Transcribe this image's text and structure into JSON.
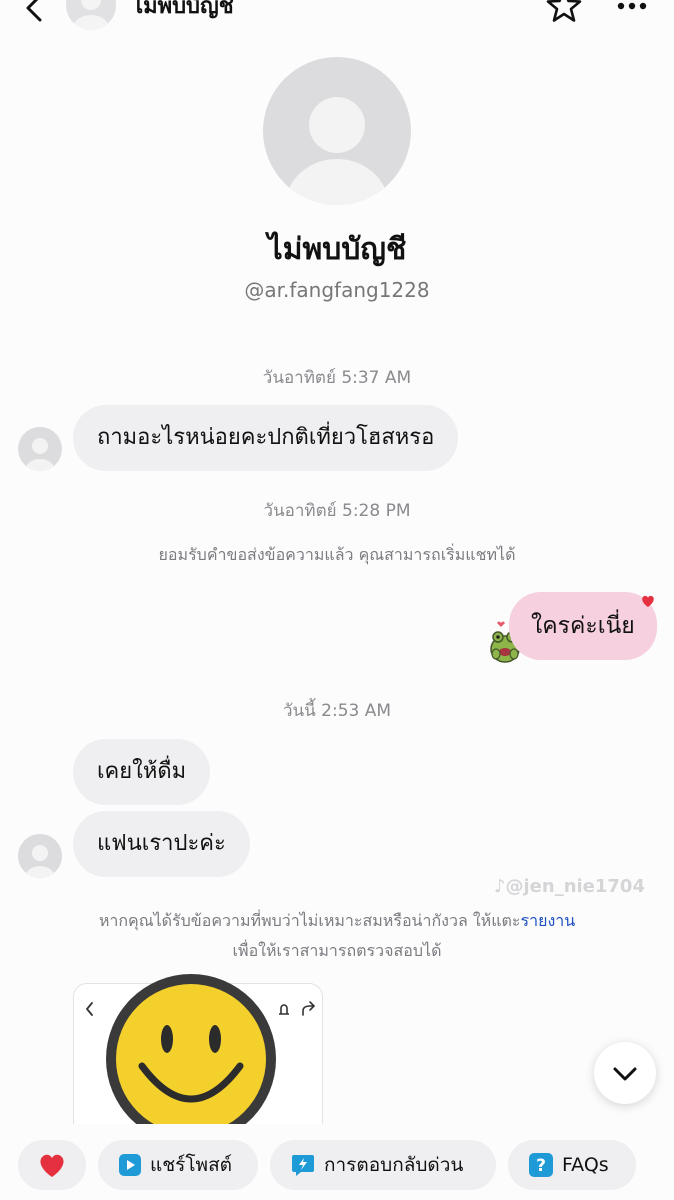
{
  "header": {
    "title": "ไม่พบบัญชี"
  },
  "profile": {
    "name": "ไม่พบบัญชี",
    "handle": "@ar.fangfang1228"
  },
  "messages": [
    {
      "type": "timestamp",
      "text": "วันอาทิตย์ 5:37 AM"
    },
    {
      "type": "incoming",
      "text": "ถามอะไรหน่อยคะปกติเที่ยวโฮสหรอ"
    },
    {
      "type": "timestamp",
      "text": "วันอาทิตย์ 5:28 PM"
    },
    {
      "type": "system",
      "text": "ยอมรับคำขอส่งข้อความแล้ว คุณสามารถเริ่มแชทได้"
    },
    {
      "type": "outgoing",
      "text": "ใครค่ะเนี่ย",
      "reaction": "heart"
    },
    {
      "type": "timestamp",
      "text": "วันนี้ 2:53 AM"
    },
    {
      "type": "incoming",
      "text": "เคยให้ดื่ม"
    },
    {
      "type": "incoming",
      "text": "แฟนเราปะค่ะ"
    }
  ],
  "watermark": "@jen_nie1704",
  "notice": {
    "text_before_link": "หากคุณได้รับข้อความที่พบว่าไม่เหมาะสมหรือน่ากังวล ให้แตะ",
    "link": "รายงาน",
    "line2": "เพื่อให้เราสามารถตรวจสอบได้"
  },
  "quick_replies": {
    "share_post": "แชร์โพสต์",
    "quick_reply": "การตอบกลับด่วน",
    "faqs": "FAQs"
  },
  "colors": {
    "background": "#fcfcfd",
    "incoming_bubble": "#efeff1",
    "outgoing_bubble": "#f6d0de",
    "link": "#1d4fc2",
    "heart": "#e5303f"
  },
  "icons": [
    "back-arrow-icon",
    "star-icon",
    "more-icon",
    "heart-icon",
    "play-icon",
    "lightning-icon",
    "question-icon",
    "chevron-down-icon",
    "smiley-sticker",
    "frog-sticker",
    "bell-icon",
    "share-icon"
  ]
}
